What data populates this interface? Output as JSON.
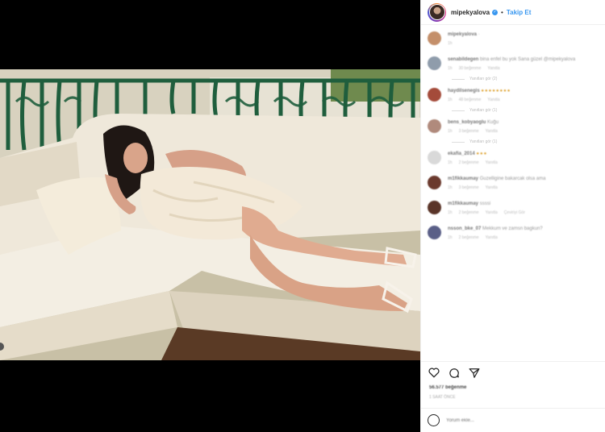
{
  "post": {
    "username": "mipekyalova",
    "verified_symbol": "✓",
    "separator": "•",
    "follow_label": "Takip Et"
  },
  "comments": [
    {
      "user": "mipekyalova",
      "text": "·",
      "meta": [
        "1h"
      ],
      "avatar": "#c48f6a",
      "reply": ""
    },
    {
      "user": "senabildegen",
      "text": "bina enfel bu yok Sana güzel @mipekyalova",
      "meta": [
        "1h",
        "30 beğenme",
        "Yanıtla"
      ],
      "avatar": "#8f9cab",
      "reply": "Yanıtları gör (2)"
    },
    {
      "user": "haydilsenegis",
      "text": "",
      "emojis": "●●●●●●●●",
      "meta": [
        "1h",
        "48 beğenme",
        "Yanıtla"
      ],
      "avatar": "#a44b3a",
      "reply": "Yanıtları gör (1)"
    },
    {
      "user": "bens_kobyaoglu",
      "text": "Kuğu",
      "meta": [
        "1h",
        "3 beğenme",
        "Yanıtla"
      ],
      "avatar": "#b08a7c",
      "reply": "Yanıtları gör (1)"
    },
    {
      "user": "ekafia_2014",
      "text": "",
      "emojis": "●●●",
      "meta": [
        "1h",
        "2 beğenme",
        "Yanıtla"
      ],
      "avatar": "#d9d9d9",
      "reply": ""
    },
    {
      "user": "m1fikkaumay",
      "text": "Guzelligine bakarcak olsa ama",
      "meta": [
        "1h",
        "3 beğenme",
        "Yanıtla"
      ],
      "avatar": "#6b3a2e",
      "reply": ""
    },
    {
      "user": "m1fikkaumay",
      "text": "ssssi",
      "meta": [
        "1h",
        "2 beğenme",
        "Yanıtla",
        "Çeviriyi Gör"
      ],
      "avatar": "#5a3428",
      "reply": ""
    },
    {
      "user": "nsson_bke_07",
      "text": "Mekkum ve zamsn bagkun?",
      "meta": [
        "1h",
        "2 beğenme",
        "Yanıtla"
      ],
      "avatar": "#5a5f87",
      "reply": ""
    }
  ],
  "footer": {
    "likes": "56.577 beğenme",
    "time": "1 SAAT ÖNCE",
    "comment_placeholder": "Yorum ekle..."
  },
  "colors": {
    "accent": "#3897f0",
    "text": "#262626",
    "border": "#efefef"
  },
  "icons": [
    "heart-icon",
    "comment-icon",
    "share-icon",
    "smiley-icon"
  ]
}
